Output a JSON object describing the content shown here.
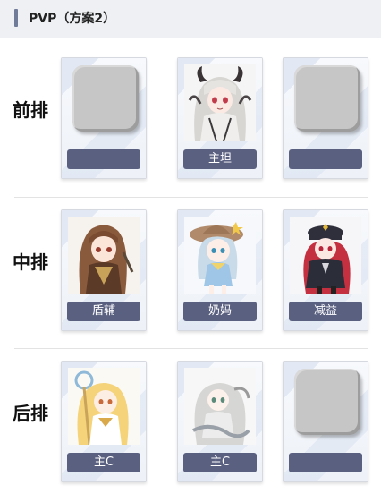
{
  "header": {
    "title": "PVP（方案2）"
  },
  "rows": [
    {
      "label": "前排",
      "cards": [
        {
          "empty": true,
          "role": ""
        },
        {
          "empty": false,
          "role": "主坦",
          "character": "dark-horned-girl"
        },
        {
          "empty": true,
          "role": ""
        }
      ]
    },
    {
      "label": "中排",
      "cards": [
        {
          "empty": false,
          "role": "盾辅",
          "character": "brown-hair-girl"
        },
        {
          "empty": false,
          "role": "奶妈",
          "character": "sunhat-girl"
        },
        {
          "empty": false,
          "role": "减益",
          "character": "officer-cap-girl"
        }
      ]
    },
    {
      "label": "后排",
      "cards": [
        {
          "empty": false,
          "role": "主C",
          "character": "blonde-staff-girl"
        },
        {
          "empty": false,
          "role": "主C",
          "character": "silver-hair-girl"
        },
        {
          "empty": true,
          "role": ""
        }
      ]
    }
  ],
  "colors": {
    "label_bg": "#5a6080",
    "accent_bar": "#707a99",
    "slot_gray": "#c6c6c6"
  }
}
